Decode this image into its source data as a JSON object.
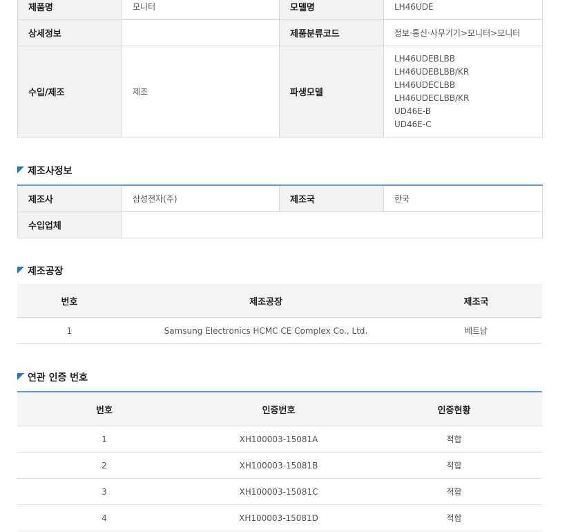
{
  "product": {
    "name_label": "제품명",
    "name_value": "모니터",
    "model_label": "모델명",
    "model_value": "LH46UDE",
    "detail_label": "상세정보",
    "detail_value": "",
    "category_label": "제품분류코드",
    "category_value": "정보·통신·사무기기>모니터>모니터",
    "import_label": "수입/제조",
    "import_value": "제조",
    "derived_label": "파생모델",
    "derived_models": [
      "LH46UDEBLBB",
      "LH46UDEBLBB/KR",
      "LH46UDECLBB",
      "LH46UDECLBB/KR",
      "UD46E-B",
      "UD46E-C"
    ]
  },
  "manufacturer": {
    "section_title": "제조사정보",
    "maker_label": "제조사",
    "maker_value": "삼성전자(주)",
    "country_label": "제조국",
    "country_value": "한국",
    "importer_label": "수입업체",
    "importer_value": ""
  },
  "factory": {
    "section_title": "제조공장",
    "headers": [
      "번호",
      "제조공장",
      "제조국"
    ],
    "rows": [
      [
        "1",
        "Samsung Electronics HCMC CE Complex Co., Ltd.",
        "베트남"
      ]
    ]
  },
  "certifications": {
    "section_title": "연관 인증 번호",
    "headers": [
      "번호",
      "인증번호",
      "인증현황"
    ],
    "rows": [
      [
        "1",
        "XH100003-15081A",
        "적합"
      ],
      [
        "2",
        "XH100003-15081B",
        "적합"
      ],
      [
        "3",
        "XH100003-15081C",
        "적합"
      ],
      [
        "4",
        "XH100003-15081D",
        "적합"
      ]
    ]
  },
  "colors": {
    "accent": "#5aa0e0",
    "marker": "#1e7bd0",
    "header_bg": "#f2f2f2"
  }
}
